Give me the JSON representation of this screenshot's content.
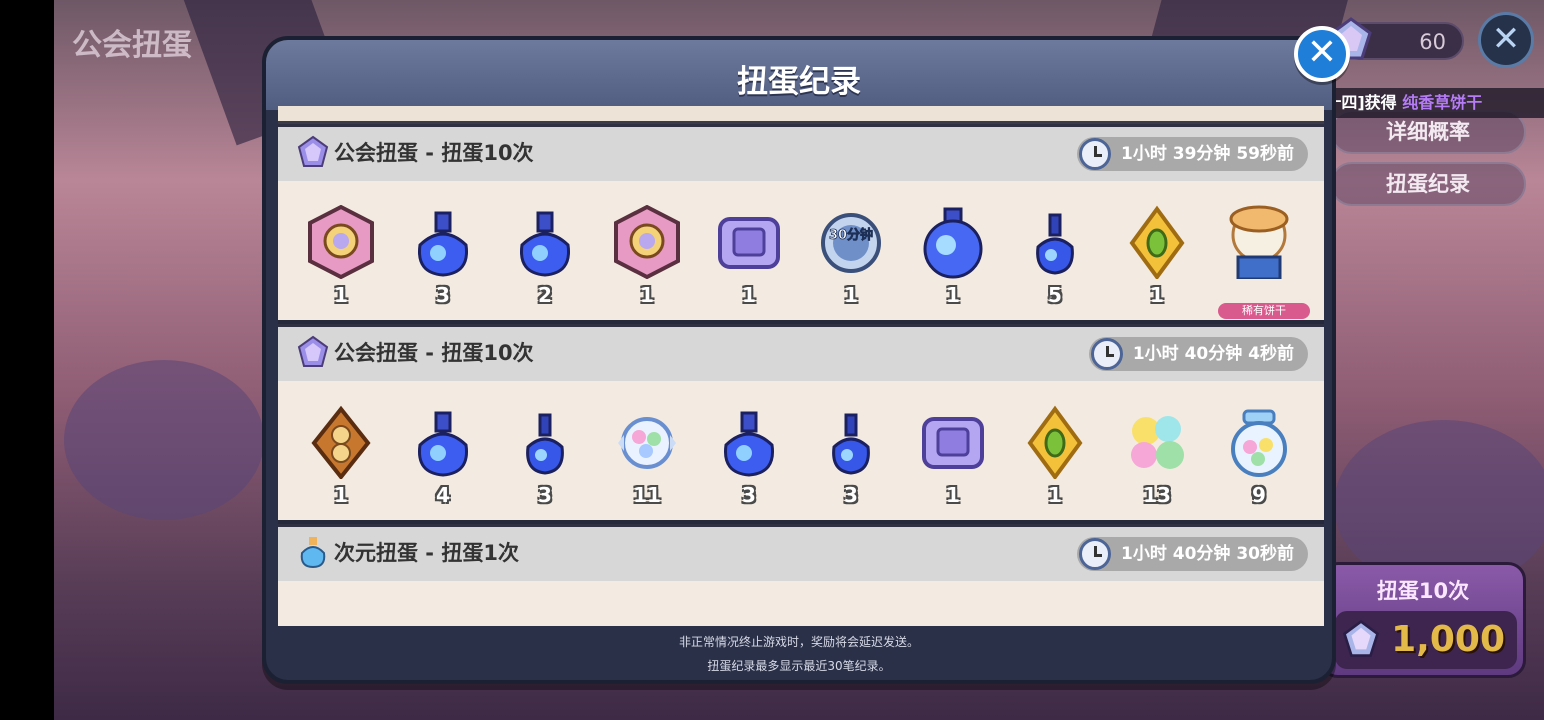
{
  "screen_title": "公会扭蛋",
  "gem_counter": {
    "value": "60"
  },
  "outer_close": "✕",
  "notice": {
    "prefix": "[苏十四]获得",
    "highlight": "纯香草饼干"
  },
  "side_buttons": {
    "detail_rate": "详细概率",
    "history": "扭蛋纪录"
  },
  "pull_button": {
    "label": "扭蛋10次",
    "cost": "1,000"
  },
  "modal": {
    "title": "扭蛋纪录",
    "close": "✕",
    "footer_line1": "非正常情况终止游戏时，奖励将会延迟发送。",
    "footer_line2": "扭蛋纪录最多显示最近30笔纪录。"
  },
  "records": [
    {
      "title": "公会扭蛋 - 扭蛋10次",
      "time": "1小时 39分钟 59秒前",
      "items": [
        {
          "icon": "pink-crest-badge-icon",
          "qty": "1"
        },
        {
          "icon": "blue-potion-bottle-icon",
          "qty": "3"
        },
        {
          "icon": "blue-potion-bottle-icon",
          "qty": "2"
        },
        {
          "icon": "pink-crest-badge-icon",
          "qty": "1"
        },
        {
          "icon": "purple-gift-chest-icon",
          "qty": "1"
        },
        {
          "icon": "30-minute-speedup-icon",
          "qty": "1",
          "overlay": "30分钟"
        },
        {
          "icon": "large-blue-potion-icon",
          "qty": "1"
        },
        {
          "icon": "small-blue-potion-icon",
          "qty": "5"
        },
        {
          "icon": "green-jelly-diamond-icon",
          "qty": "1"
        },
        {
          "icon": "cookie-character-portrait-icon",
          "qty": "",
          "tag": "稀有饼干"
        }
      ]
    },
    {
      "title": "公会扭蛋 - 扭蛋10次",
      "time": "1小时 40分钟 4秒前",
      "items": [
        {
          "icon": "coin-diamond-token-icon",
          "qty": "1"
        },
        {
          "icon": "blue-potion-bottle-icon",
          "qty": "4"
        },
        {
          "icon": "small-blue-potion-icon",
          "qty": "3"
        },
        {
          "icon": "candy-wrapper-icon",
          "qty": "11"
        },
        {
          "icon": "blue-potion-bottle-icon",
          "qty": "3"
        },
        {
          "icon": "small-blue-potion-icon",
          "qty": "3"
        },
        {
          "icon": "purple-gift-chest-icon",
          "qty": "1"
        },
        {
          "icon": "green-jelly-diamond-icon",
          "qty": "1"
        },
        {
          "icon": "flower-candy-cluster-icon",
          "qty": "13"
        },
        {
          "icon": "candy-jar-icon",
          "qty": "9"
        }
      ]
    },
    {
      "title": "次元扭蛋 - 扭蛋1次",
      "time": "1小时 40分钟 30秒前",
      "items": []
    }
  ],
  "colors": {
    "modal_bg": "#2a3048",
    "header": "#5f6b90",
    "record_bg": "#f3ebe1",
    "record_head": "#d7d7d7",
    "close_blue": "#1f7ed8",
    "notice_highlight": "#b57cf5",
    "cost_gold": "#e3b94a"
  }
}
